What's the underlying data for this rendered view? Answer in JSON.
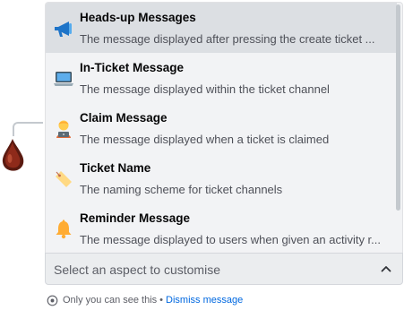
{
  "options": [
    {
      "icon": "megaphone-icon",
      "title": "Heads-up Messages",
      "description": "The message displayed after pressing the create ticket ..."
    },
    {
      "icon": "laptop-icon",
      "title": "In-Ticket Message",
      "description": "The message displayed within the ticket channel"
    },
    {
      "icon": "technologist-icon",
      "title": "Claim Message",
      "description": "The message displayed when a ticket is claimed"
    },
    {
      "icon": "label-tag-icon",
      "title": "Ticket Name",
      "description": "The naming scheme for ticket channels"
    },
    {
      "icon": "bell-icon",
      "title": "Reminder Message",
      "description": "The message displayed to users when given an activity r..."
    }
  ],
  "select": {
    "placeholder": "Select an aspect to customise",
    "expanded": true
  },
  "ephemeral": {
    "note": "Only you can see this",
    "separator": "•",
    "dismiss": "Dismiss message"
  },
  "colors": {
    "selected_bg": "#dcdfe3",
    "link": "#0068e0",
    "menu_bg": "#f2f3f5"
  }
}
